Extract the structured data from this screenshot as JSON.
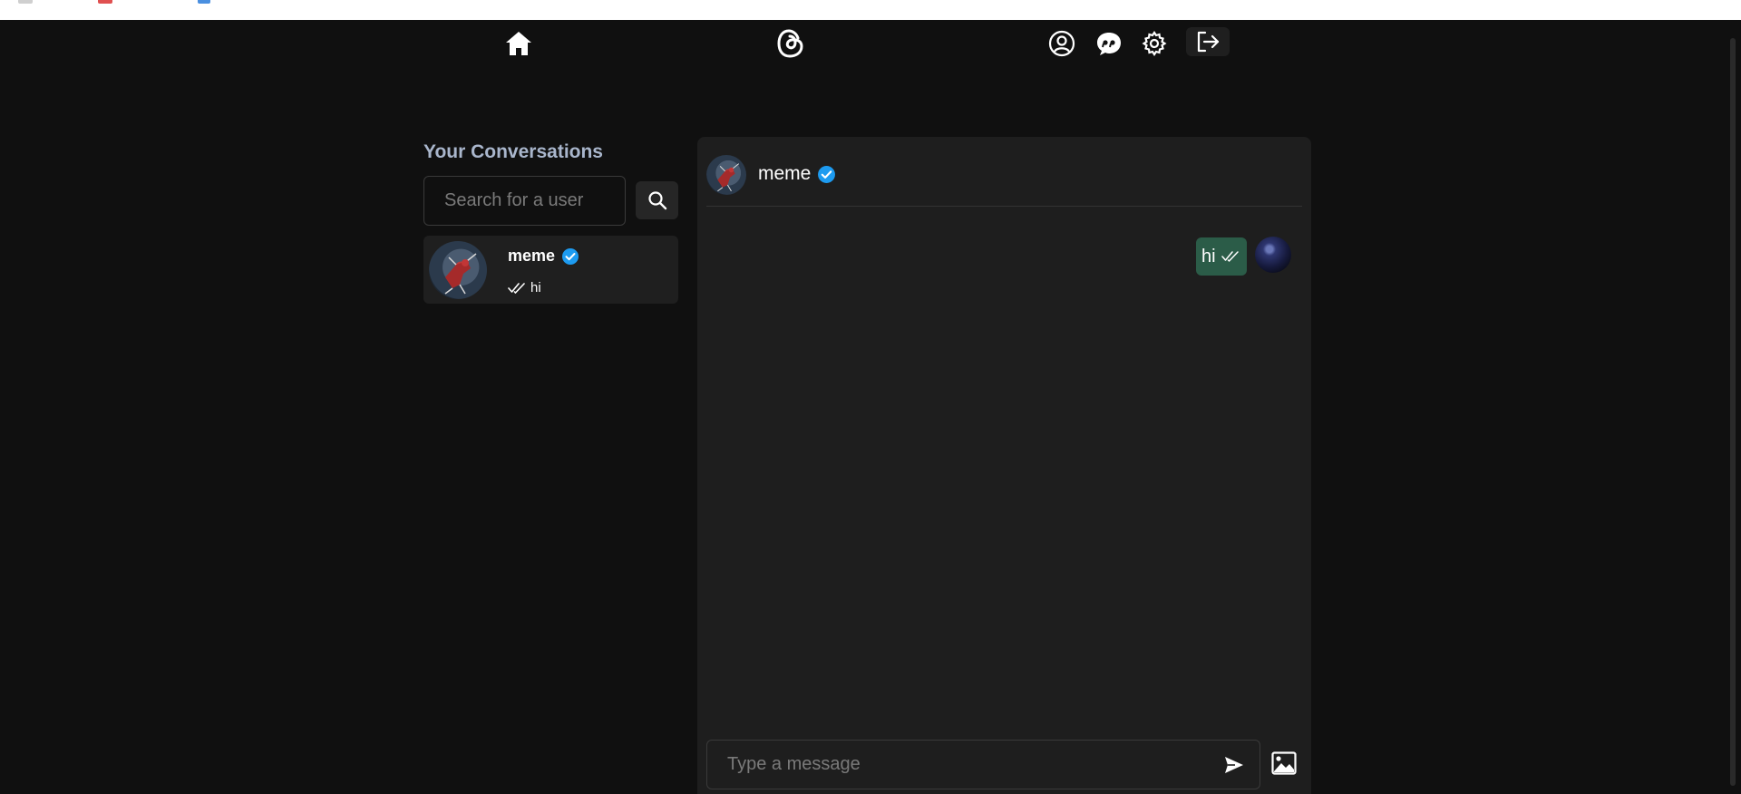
{
  "nav": {
    "icons": [
      "home-icon",
      "threads-logo-icon",
      "profile-icon",
      "chat-icon",
      "settings-icon",
      "logout-icon"
    ]
  },
  "sidebar": {
    "title": "Your Conversations",
    "search_placeholder": "Search for a user",
    "conversations": [
      {
        "name": "meme",
        "verified": true,
        "last_message": "hi",
        "seen": true
      }
    ]
  },
  "chat": {
    "header_name": "meme",
    "verified": true,
    "messages": [
      {
        "text": "hi",
        "own": true,
        "seen": true
      }
    ],
    "input_placeholder": "Type a message"
  },
  "colors": {
    "background": "#101010",
    "panel": "#1e1e1e",
    "title": "#a9b6cc",
    "verified": "#1d9bf0",
    "own_bubble": "#2b5c48"
  }
}
